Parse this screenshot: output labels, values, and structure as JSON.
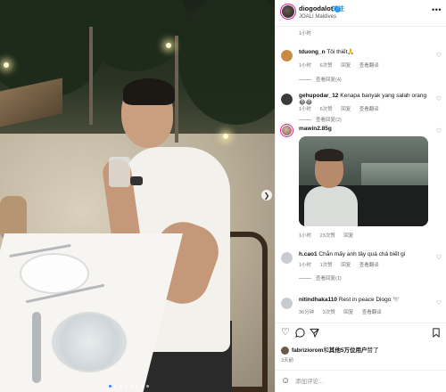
{
  "post": {
    "username": "diogodalot",
    "follow_label": "关注",
    "location": "JOALI Maldives",
    "more_icon": "more-icon"
  },
  "comments": [
    {
      "meta_time": "1小时",
      "meta_likes": "",
      "meta_reply": "",
      "meta_translate": ""
    },
    {
      "username": "tduong_n",
      "text": "Tôi thiết🙏",
      "meta_time": "1小时",
      "meta_likes": "6次赞",
      "meta_reply": "回复",
      "meta_translate": "查看翻译",
      "view_replies": "查看回复(4)"
    },
    {
      "username": "gehupodar_12",
      "text": "Kenapa banyak yang salah orang😂😂",
      "meta_time": "1小时",
      "meta_likes": "6次赞",
      "meta_reply": "回复",
      "meta_translate": "查看翻译",
      "view_replies": "查看回复(2)"
    },
    {
      "username": "mawin2.85g",
      "meta_time": "1小时",
      "meta_likes": "23次赞",
      "meta_reply": "回复"
    },
    {
      "username": "h.cao1",
      "text": "Chắn mấy anh tây quá chả biết gì",
      "meta_time": "1小时",
      "meta_likes": "1次赞",
      "meta_reply": "回复",
      "meta_translate": "查看翻译",
      "view_replies": "查看回复(1)"
    },
    {
      "username": "nitindhaka110",
      "text": "Rest in peace Diogo 🕊️",
      "meta_time": "36分钟",
      "meta_likes": "3次赞",
      "meta_reply": "回复",
      "meta_translate": "查看翻译"
    }
  ],
  "likes": {
    "liker": "fabriziorom",
    "middle": "和",
    "others": "其他5万位用户",
    "tail": "赞了"
  },
  "post_date": "3天前",
  "add_comment": {
    "placeholder": "添加评论..."
  },
  "colors": {
    "accent_blue": "#0095f6",
    "meta_gray": "#737373",
    "story_ring": "#d6249f"
  }
}
